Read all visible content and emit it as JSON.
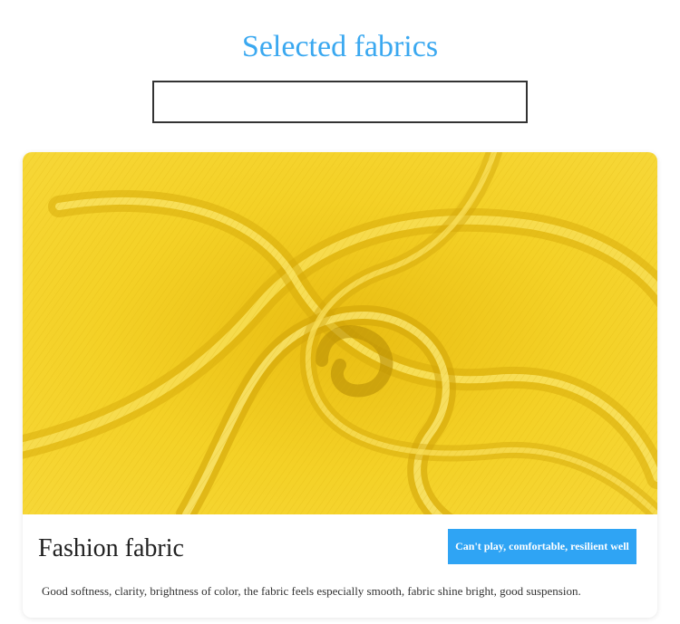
{
  "header": {
    "title": "Selected fabrics"
  },
  "card": {
    "image_subject": "yellow-fabric-swirl",
    "title": "Fashion fabric",
    "tag_label": "Can't play, comfortable, resilient well",
    "description": "Good softness, clarity, brightness of color, the fabric feels especially smooth, fabric shine bright, good suspension."
  },
  "colors": {
    "title": "#3aa8f0",
    "tag_background": "#2fa4f4",
    "fabric": "#f5d21f"
  }
}
